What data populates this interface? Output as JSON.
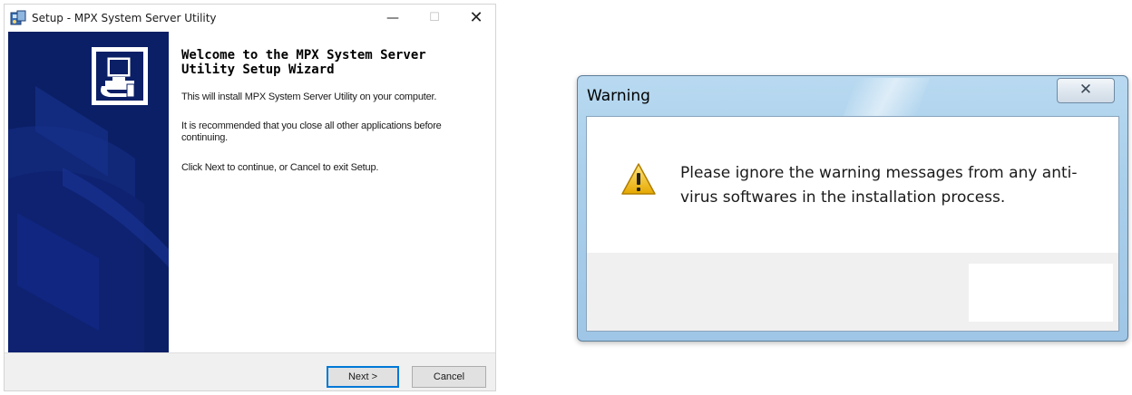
{
  "setup_window": {
    "title": "Setup - MPX System Server Utility",
    "controls": {
      "minimize": "—",
      "maximize": "☐",
      "close": "✕"
    },
    "heading": "Welcome to the MPX System Server Utility Setup Wizard",
    "paragraphs": [
      "This will install MPX System Server Utility on your computer.",
      "It is recommended that you close all other applications before continuing.",
      "Click Next to continue, or Cancel to exit Setup."
    ],
    "buttons": {
      "next": "Next >",
      "cancel": "Cancel"
    },
    "banner_color": "#0b1f66"
  },
  "warning_dialog": {
    "title": "Warning",
    "close_glyph": "✕",
    "message": "Please ignore the warning messages from any anti-virus softwares in the installation process.",
    "icon": "warning-triangle-icon",
    "icon_color": "#f2c200"
  }
}
